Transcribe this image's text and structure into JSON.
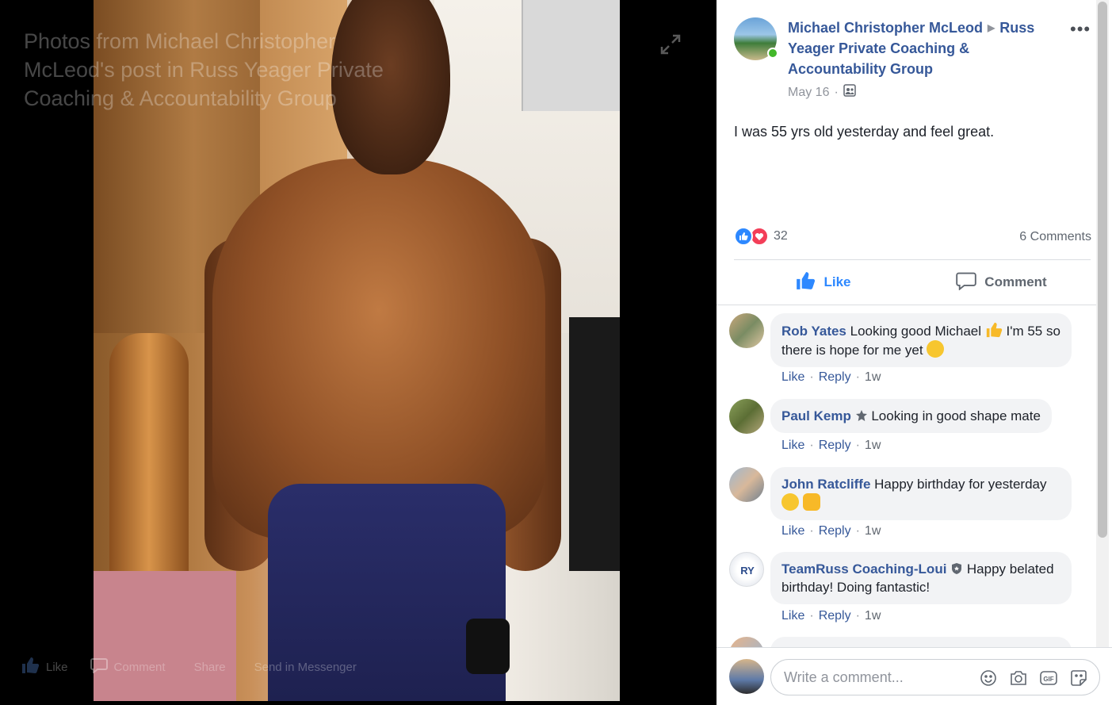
{
  "stage": {
    "title": "Photos from Michael Christopher McLeod's post in Russ Yeager Private Coaching & Accountability Group",
    "actions": [
      {
        "label": "Like",
        "icon": "thumbs-up-icon"
      },
      {
        "label": "Comment",
        "icon": "comment-icon"
      },
      {
        "label": "Share",
        "icon": "share-icon"
      },
      {
        "label": "Send in Messenger",
        "icon": "messenger-icon"
      }
    ]
  },
  "post": {
    "author": "Michael Christopher McLeod",
    "group": "Russ Yeager Private Coaching & Accountability Group",
    "date": "May 16",
    "privacy_icon": "group-icon",
    "body": "I was 55 yrs old yesterday and feel great.",
    "reaction_count": "32",
    "comments_count": "6 Comments",
    "like_label": "Like",
    "comment_label": "Comment"
  },
  "comments": [
    {
      "name": "Rob Yates",
      "text_a": "Looking good Michael",
      "text_b": "I'm 55 so there is hope for me yet",
      "like": "Like",
      "reply": "Reply",
      "time": "1w"
    },
    {
      "name": "Paul Kemp",
      "text_a": "Looking in good shape mate",
      "like": "Like",
      "reply": "Reply",
      "time": "1w"
    },
    {
      "name": "John Ratcliffe",
      "text_a": "Happy birthday for yesterday",
      "like": "Like",
      "reply": "Reply",
      "time": "1w"
    },
    {
      "name": "TeamRuss Coaching-Loui",
      "text_a": "Happy belated birthday! Doing fantastic!",
      "like": "Like",
      "reply": "Reply",
      "time": "1w"
    }
  ],
  "composer": {
    "placeholder": "Write a comment...",
    "icons": [
      "emoji-icon",
      "camera-icon",
      "gif-icon",
      "sticker-icon"
    ]
  },
  "colors": {
    "link": "#365899",
    "like_blue": "#2d88ff",
    "love_red": "#f33e58",
    "online_green": "#42b72a"
  }
}
